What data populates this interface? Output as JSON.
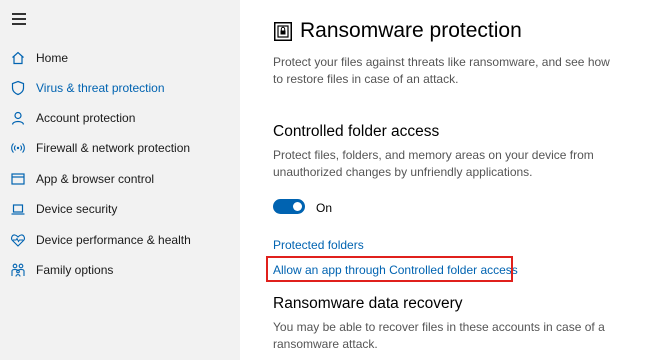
{
  "sidebar": {
    "items": [
      {
        "label": "Home",
        "icon": "home-icon"
      },
      {
        "label": "Virus & threat protection",
        "icon": "shield-icon",
        "active": true
      },
      {
        "label": "Account protection",
        "icon": "person-icon"
      },
      {
        "label": "Firewall & network protection",
        "icon": "antenna-icon"
      },
      {
        "label": "App & browser control",
        "icon": "browser-window-icon"
      },
      {
        "label": "Device security",
        "icon": "laptop-icon"
      },
      {
        "label": "Device performance & health",
        "icon": "heart-pulse-icon"
      },
      {
        "label": "Family options",
        "icon": "family-icon"
      }
    ]
  },
  "main": {
    "title": "Ransomware protection",
    "description": "Protect your files against threats like ransomware, and see how to restore files in case of an attack.",
    "cfa": {
      "title": "Controlled folder access",
      "description": "Protect files, folders, and memory areas on your device from unauthorized changes by unfriendly applications.",
      "toggle_label": "On",
      "toggle_on": true,
      "link_protected_folders": "Protected folders",
      "link_allow_app": "Allow an app through Controlled folder access"
    },
    "recovery": {
      "title": "Ransomware data recovery",
      "description": "You may be able to recover files in these accounts in case of a ransomware attack."
    }
  },
  "colors": {
    "accent": "#0063b1",
    "sidebar_bg": "#f2f2f2",
    "highlight": "#e0201c"
  }
}
